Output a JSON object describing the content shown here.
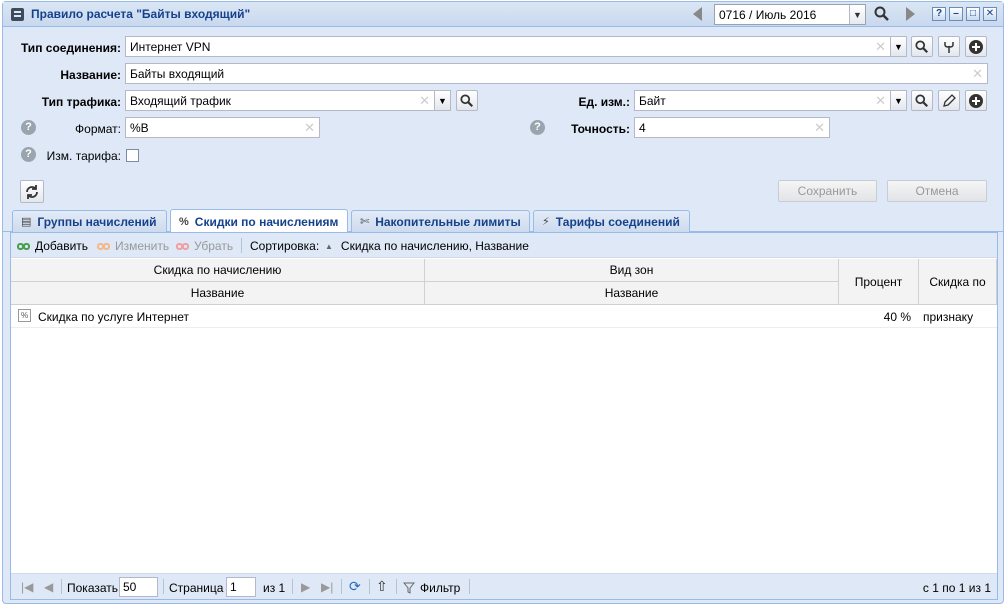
{
  "window": {
    "title": "Правило расчета \"Байты входящий\"",
    "period": "0716 / Июль 2016"
  },
  "form": {
    "connection_type_label": "Тип соединения:",
    "connection_type_value": "Интернет VPN",
    "name_label": "Название:",
    "name_value": "Байты входящий",
    "traffic_type_label": "Тип трафика:",
    "traffic_type_value": "Входящий трафик",
    "unit_label": "Ед. изм.:",
    "unit_value": "Байт",
    "format_label": "Формат:",
    "format_value": "%B",
    "precision_label": "Точность:",
    "precision_value": "4",
    "tariff_change_label": "Изм. тарифа:",
    "tariff_change_checked": false,
    "save_label": "Сохранить",
    "cancel_label": "Отмена"
  },
  "tabs": [
    {
      "label": "Группы начислений",
      "icon": "group-icon",
      "active": false
    },
    {
      "label": "Скидки по начислениям",
      "icon": "discount-icon",
      "active": true
    },
    {
      "label": "Накопительные лимиты",
      "icon": "scissors-icon",
      "active": false
    },
    {
      "label": "Тарифы соединений",
      "icon": "network-icon",
      "active": false
    }
  ],
  "toolbar": {
    "add_label": "Добавить",
    "edit_label": "Изменить",
    "remove_label": "Убрать",
    "sort_label": "Сортировка:",
    "sort_value": "Скидка по начислению, Название"
  },
  "grid": {
    "group1_header": "Скидка по начислению",
    "group1_sub": "Название",
    "group2_header": "Вид зон",
    "group2_sub": "Название",
    "percent_header": "Процент",
    "discount_by_header": "Скидка по",
    "rows": [
      {
        "name": "Скидка по услуге Интернет",
        "zone": "",
        "percent": "40 %",
        "discount_by": "признаку"
      }
    ]
  },
  "pager": {
    "show_label": "Показать",
    "page_size": "50",
    "page_label": "Страница",
    "page": "1",
    "of_label": "из 1",
    "filter_label": "Фильтр",
    "summary": "с 1 по 1 из 1"
  }
}
